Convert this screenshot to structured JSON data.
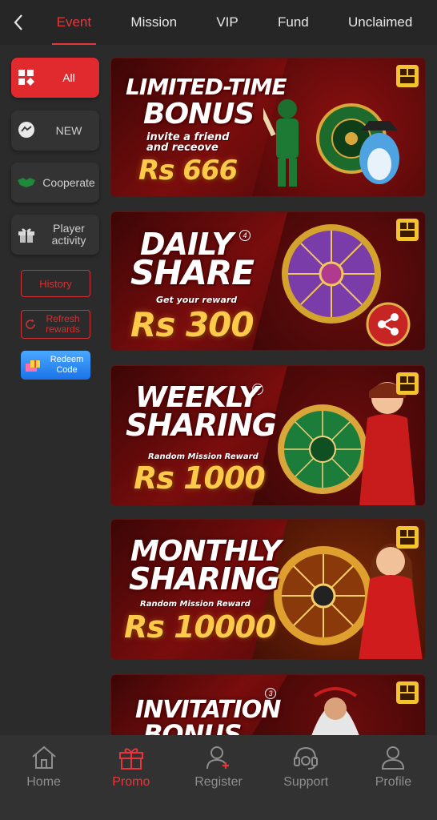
{
  "header": {
    "tabs": [
      {
        "label": "Event",
        "active": true
      },
      {
        "label": "Mission"
      },
      {
        "label": "VIP"
      },
      {
        "label": "Fund"
      },
      {
        "label": "Unclaimed"
      }
    ]
  },
  "sidebar": {
    "categories": [
      {
        "label": "All",
        "icon": "grid-icon",
        "active": true
      },
      {
        "label": "NEW",
        "icon": "chat-bubble-icon"
      },
      {
        "label": "Cooperate",
        "icon": "handshake-icon"
      },
      {
        "label": "Player activity",
        "icon": "gift-box-icon"
      }
    ],
    "history_label": "History",
    "refresh_label": "Refresh rewards",
    "redeem_label": "Redeem Code"
  },
  "banners": [
    {
      "title_line1": "LIMITED-TIME",
      "title_line2": "BONUS",
      "subtitle": "invite a friend and receove",
      "amount": "Rs 666",
      "number": ""
    },
    {
      "title_line1": "DAILY",
      "title_line2": "SHARE",
      "subtitle": "Get your reward",
      "amount": "Rs 300",
      "number": "4"
    },
    {
      "title_line1": "WEEKLY",
      "title_line2": "SHARING",
      "subtitle": "Random Mission Reward",
      "amount": "Rs 1000",
      "number": "5"
    },
    {
      "title_line1": "MONTHLY",
      "title_line2": "SHARING",
      "subtitle": "Random Mission Reward",
      "amount": "Rs 10000",
      "number": ""
    },
    {
      "title_line1": "INVITATION",
      "title_line2": "BONUS",
      "subtitle": "",
      "amount": "",
      "number": "3"
    }
  ],
  "bottom_nav": [
    {
      "label": "Home",
      "icon": "home-icon"
    },
    {
      "label": "Promo",
      "icon": "gift-icon",
      "active": true
    },
    {
      "label": "Register",
      "icon": "add-user-icon"
    },
    {
      "label": "Support",
      "icon": "headset-icon"
    },
    {
      "label": "Profile",
      "icon": "user-icon"
    }
  ],
  "colors": {
    "accent": "#e8363a",
    "background": "#2b2b2b",
    "gold": "#ffc94a"
  }
}
